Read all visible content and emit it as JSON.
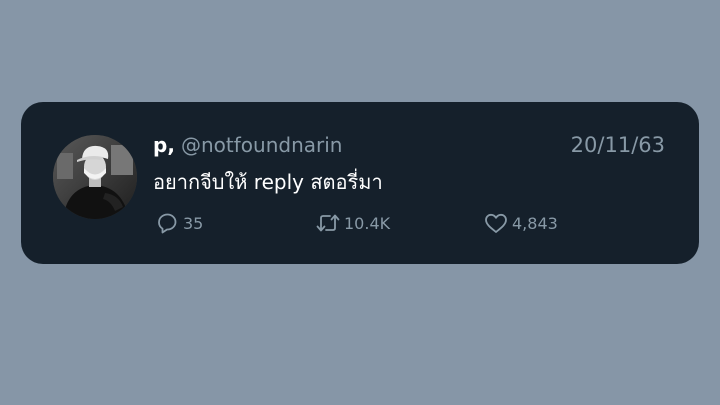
{
  "tweet": {
    "display_name": "p,",
    "handle": "@notfoundnarin",
    "date": "20/11/63",
    "text": "อยากจีบให้ reply สตอรี่มา",
    "stats": {
      "replies": "35",
      "retweets": "10.4K",
      "likes": "4,843"
    }
  },
  "colors": {
    "background": "#8696a7",
    "card": "#15202b",
    "text_primary": "#ffffff",
    "text_secondary": "#8899a6"
  },
  "icons": {
    "reply": "reply-icon",
    "retweet": "retweet-icon",
    "like": "like-icon"
  }
}
